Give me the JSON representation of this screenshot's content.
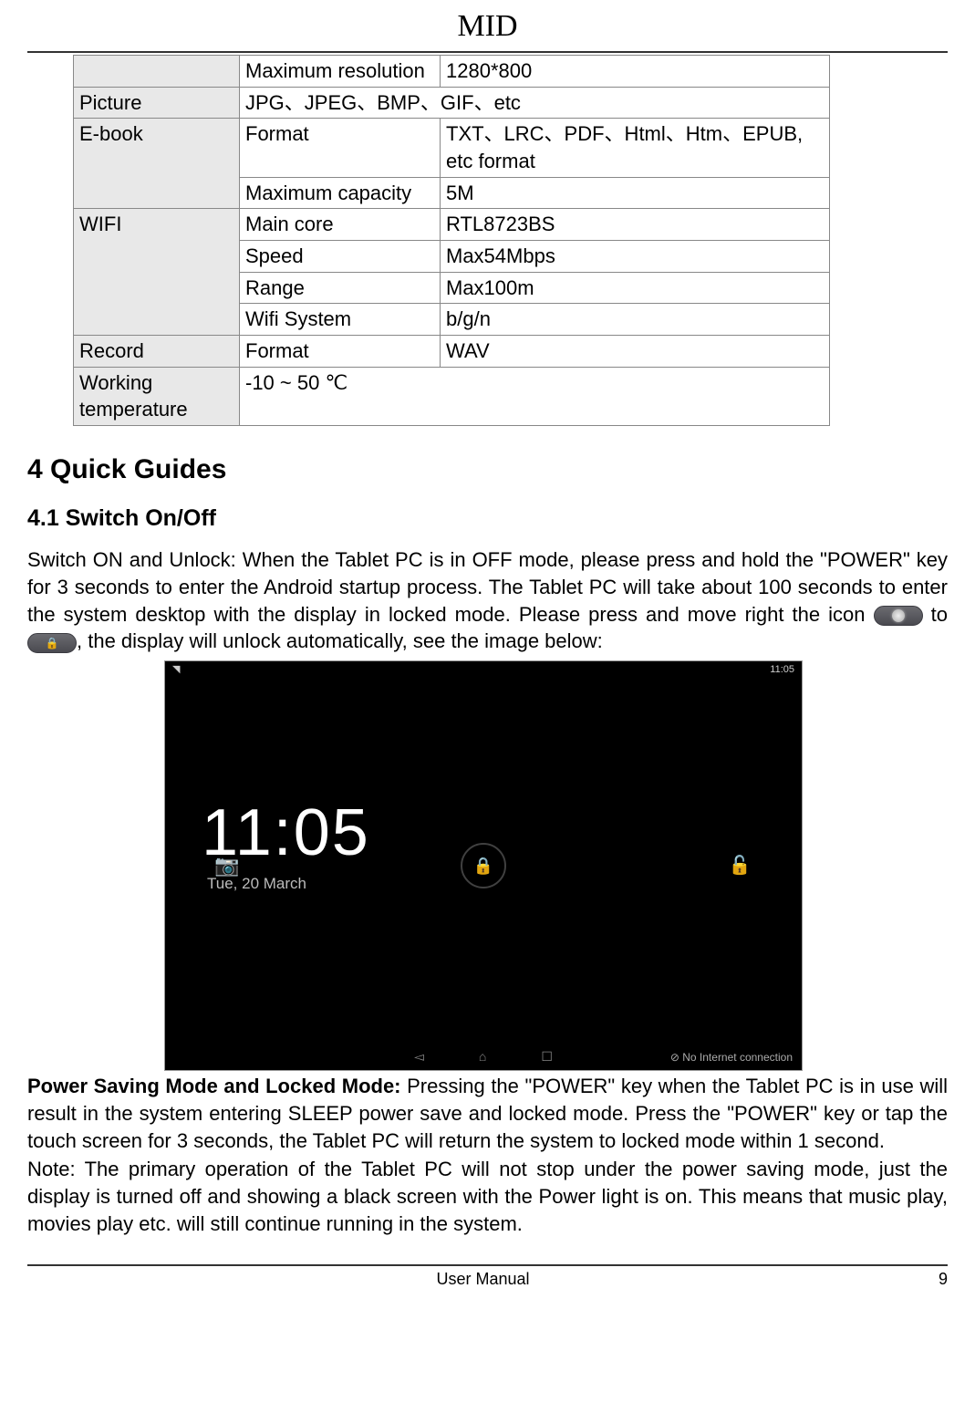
{
  "header": {
    "doc_title": "MID"
  },
  "table": {
    "r1": {
      "sub": "Maximum resolution",
      "val": "1280*800"
    },
    "r2": {
      "label": "Picture",
      "val": "JPG、JPEG、BMP、GIF、etc"
    },
    "r3": {
      "label": "E-book",
      "sub1": "Format",
      "val1": "TXT、LRC、PDF、Html、Htm、EPUB, etc format",
      "sub2": "Maximum capacity",
      "val2": "5M"
    },
    "r4": {
      "label": "WIFI",
      "sub1": "Main core",
      "val1": "RTL8723BS",
      "sub2": "Speed",
      "val2": "Max54Mbps",
      "sub3": "Range",
      "val3": "Max100m",
      "sub4": "Wifi System",
      "val4": "b/g/n"
    },
    "r5": {
      "label": "Record",
      "sub": "Format",
      "val": "WAV"
    },
    "r6": {
      "label": "Working temperature",
      "val": "-10   ~ 50 ℃"
    }
  },
  "headings": {
    "h1": "4 Quick Guides",
    "h2": "4.1 Switch On/Off"
  },
  "para": {
    "p1a": "Switch ON and Unlock: When the Tablet PC is in OFF mode, please press and hold the \"POWER\" key for 3 seconds to enter the Android startup process. The Tablet PC will take about 100 seconds to enter the system desktop with the display in locked mode. Please press and move right the icon",
    "p1b": " to",
    "p1c": ", the display will unlock automatically, see the image below:",
    "p2_lead": "Power Saving Mode and Locked Mode: ",
    "p2": "Pressing the \"POWER\" key when the Tablet PC is in use will result in the system entering SLEEP power save and locked mode. Press the \"POWER\" key or tap the touch screen for 3 seconds, the Tablet PC will return the system to locked mode within 1 second.",
    "p3": "Note: The primary operation of the Tablet PC will not stop under the power saving mode, just the display is turned off and showing a black screen with the Power light is on. This means that music play, movies play etc. will still continue running in the system."
  },
  "screenshot": {
    "status_time": "11:05",
    "clock_time": "11:05",
    "clock_date": "Tue, 20 March",
    "net_msg": "No Internet connection"
  },
  "footer": {
    "center": "User Manual",
    "page": "9"
  }
}
